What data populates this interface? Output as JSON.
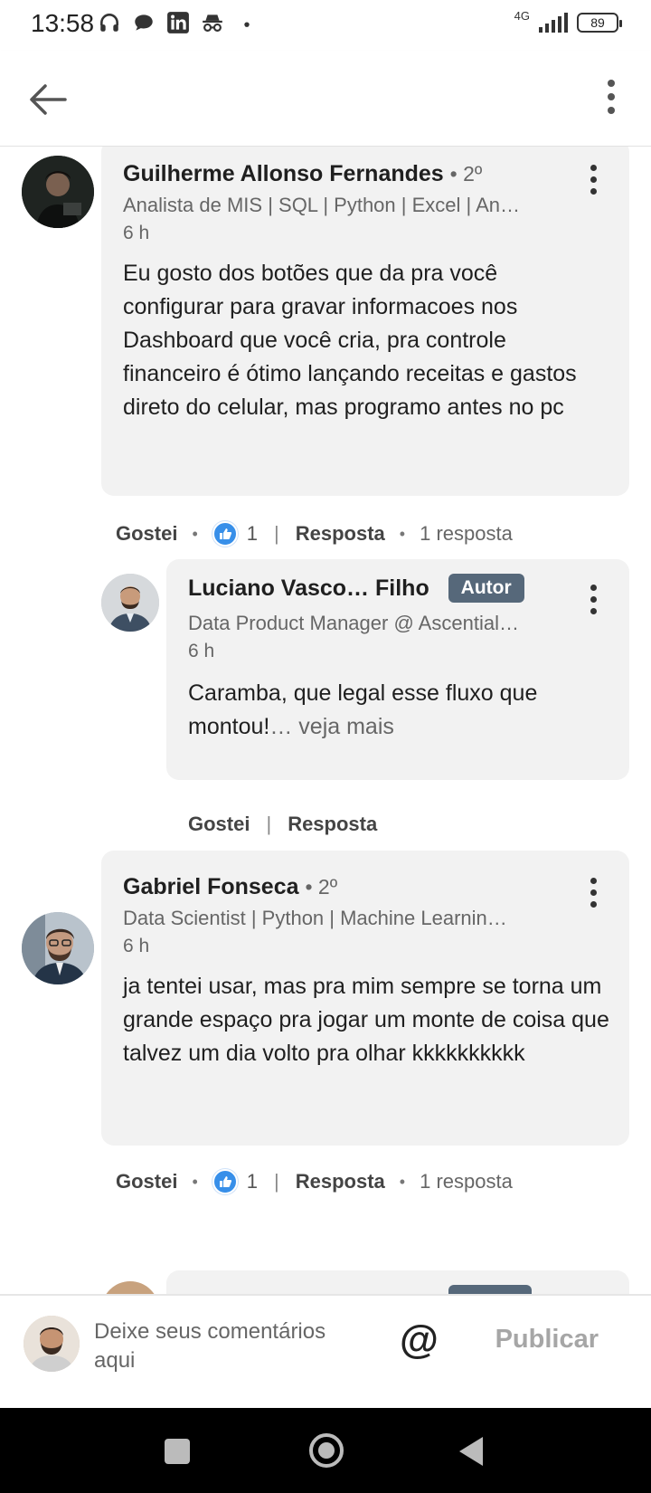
{
  "status_bar": {
    "time": "13:58",
    "network": "4G",
    "battery": "89",
    "icons": [
      "headphones-icon",
      "chat-icon",
      "linkedin-icon",
      "incognito-icon",
      "dot-icon"
    ]
  },
  "app_bar": {
    "back_icon": "arrow-left-icon",
    "menu_icon": "more-vertical-icon"
  },
  "comments": [
    {
      "author": "Guilherme Allonso Fernandes",
      "degree": "• 2º",
      "headline": "Analista de MIS | SQL | Python | Excel | An…",
      "time": "6 h",
      "text": "Eu gosto dos botões que da pra você configurar para gravar informacoes nos Dashboard que você cria, pra controle financeiro é ótimo lançando receitas e gastos direto do celular, mas programo antes no pc",
      "actions": {
        "like": "Gostei",
        "like_count": "1",
        "reply": "Resposta",
        "replies": "1 resposta"
      },
      "reply": {
        "author": "Luciano Vasco… Filho",
        "badge": "Autor",
        "headline": "Data Product Manager @ Ascential…",
        "time": "6 h",
        "text": "Caramba, que legal esse fluxo que montou!",
        "see_more": "… veja mais",
        "actions": {
          "like": "Gostei",
          "reply": "Resposta"
        }
      }
    },
    {
      "author": "Gabriel Fonseca",
      "degree": "• 2º",
      "headline": "Data Scientist | Python | Machine Learnin…",
      "time": "6 h",
      "text": "ja tentei usar, mas pra mim sempre se torna um grande espaço pra jogar um monte de coisa que talvez um dia volto pra olhar kkkkkkkkkk",
      "actions": {
        "like": "Gostei",
        "like_count": "1",
        "reply": "Resposta",
        "replies": "1 resposta"
      }
    }
  ],
  "composer": {
    "placeholder": "Deixe seus comentários aqui",
    "mention": "@",
    "publish": "Publicar"
  },
  "colors": {
    "bubble": "#f2f2f2",
    "like_blue": "#378fe9",
    "author_badge": "#56687a"
  }
}
